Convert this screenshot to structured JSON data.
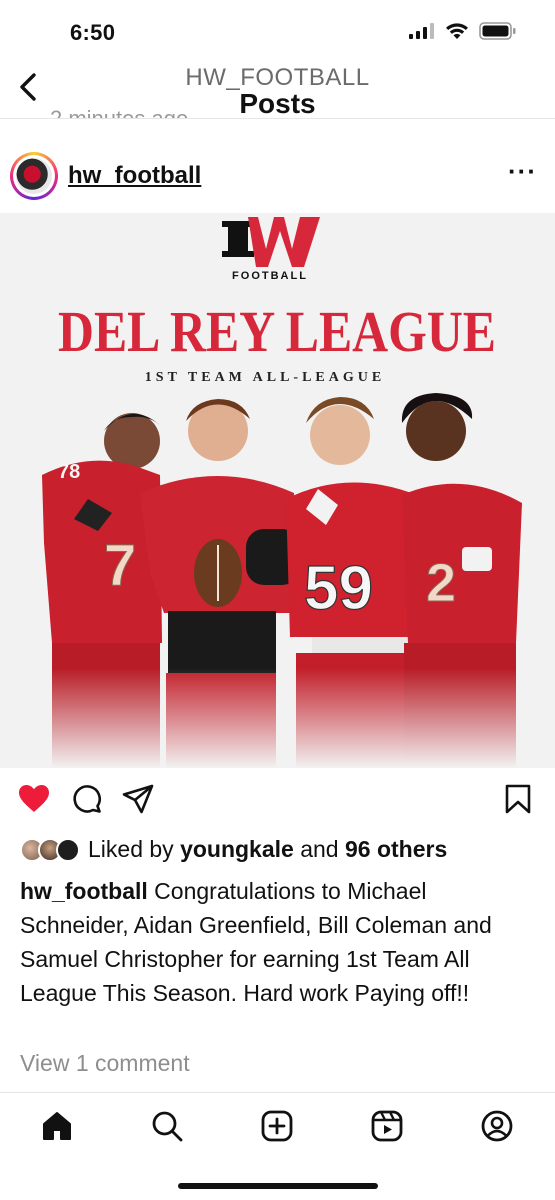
{
  "status": {
    "time": "6:50"
  },
  "header": {
    "username": "HW_FOOTBALL",
    "title": "Posts",
    "ghost_text": "2 minutes ago"
  },
  "post": {
    "username": "hw_football",
    "image": {
      "logo_text": "FOOTBALL",
      "headline": "DEL REY LEAGUE",
      "subhead": "1ST TEAM ALL-LEAGUE",
      "jersey_numbers": [
        "78",
        "7",
        "59",
        "2"
      ]
    },
    "likes": {
      "prefix": "Liked by",
      "user": "youngkale",
      "and": "and",
      "others": "96 others"
    },
    "caption": {
      "user": "hw_football",
      "text": "Congratulations to Michael Schneider, Aidan Greenfield, Bill Coleman and Samuel Christopher for earning 1st Team All League This Season. Hard work Paying off!!"
    },
    "view_comments": "View 1 comment"
  },
  "colors": {
    "like_red": "#ed1c3a",
    "brand_red": "#d6283a"
  },
  "icons": {
    "actions": [
      "heart-icon",
      "comment-icon",
      "share-icon",
      "bookmark-icon"
    ],
    "tabs": [
      "home-icon",
      "search-icon",
      "create-icon",
      "reels-icon",
      "profile-icon"
    ]
  }
}
